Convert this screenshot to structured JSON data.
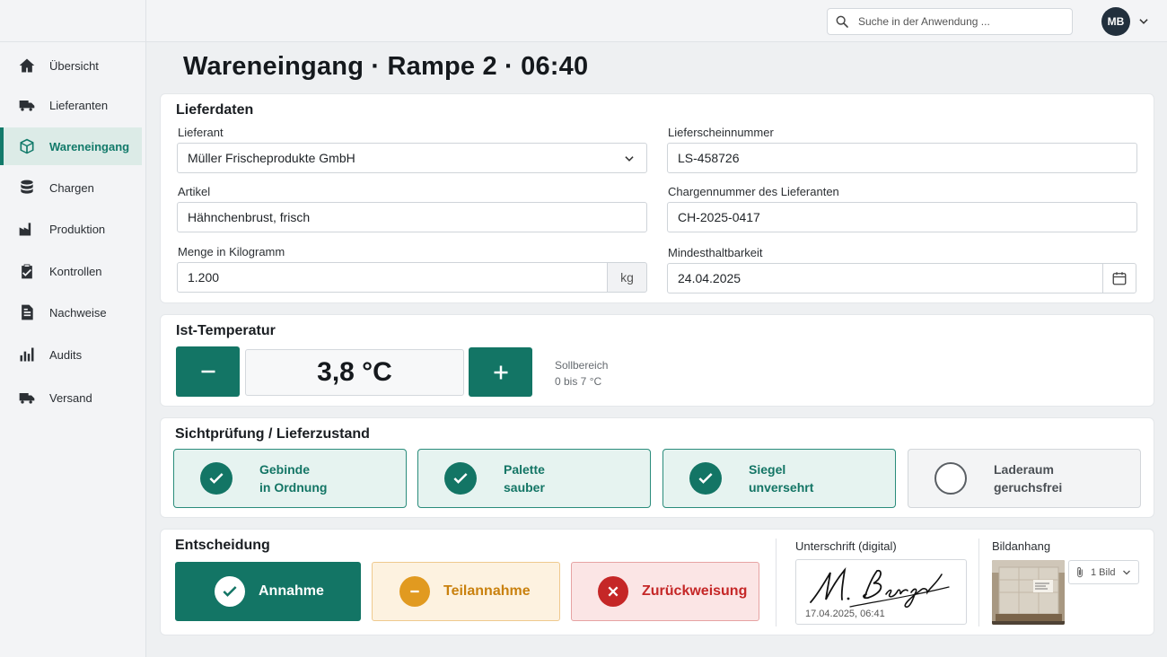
{
  "sidebar": {
    "items": [
      {
        "label": "Übersicht",
        "icon": "home-icon"
      },
      {
        "label": "Lieferanten",
        "icon": "truck-icon"
      },
      {
        "label": "Wareneingang",
        "icon": "box-icon",
        "active": true
      },
      {
        "label": "Chargen",
        "icon": "database-icon"
      },
      {
        "label": "Produktion",
        "icon": "factory-icon"
      },
      {
        "label": "Kontrollen",
        "icon": "clipboard-check-icon"
      },
      {
        "label": "Nachweise",
        "icon": "document-icon"
      },
      {
        "label": "Audits",
        "icon": "bar-chart-icon"
      },
      {
        "label": "Versand",
        "icon": "truck-icon"
      }
    ]
  },
  "header": {
    "search_placeholder": "Suche in der Anwendung ...",
    "avatar_initials": "MB"
  },
  "page": {
    "title": "Wareneingang · Rampe 2 · 06:40"
  },
  "lieferdaten": {
    "title": "Lieferdaten",
    "lieferant_label": "Lieferant",
    "lieferant_value": "Müller Frischeprodukte GmbH",
    "lieferschein_label": "Lieferscheinnummer",
    "lieferschein_value": "LS-458726",
    "artikel_label": "Artikel",
    "artikel_value": "Hähnchenbrust, frisch",
    "charge_label": "Chargennummer des Lieferanten",
    "charge_value": "CH-2025-0417",
    "menge_label": "Menge in Kilogramm",
    "menge_value": "1.200",
    "menge_unit": "kg",
    "mhd_label": "Mindesthaltbarkeit",
    "mhd_value": "24.04.2025"
  },
  "temperatur": {
    "title": "Ist-Temperatur",
    "value": "3,8 °C",
    "soll_label": "Sollbereich",
    "soll_range": "0 bis 7 °C"
  },
  "sichtpruefung": {
    "title": "Sichtprüfung / Lieferzustand",
    "items": [
      {
        "line1": "Gebinde",
        "line2": "in Ordnung",
        "checked": true
      },
      {
        "line1": "Palette",
        "line2": "sauber",
        "checked": true
      },
      {
        "line1": "Siegel",
        "line2": "unversehrt",
        "checked": true
      },
      {
        "line1": "Laderaum",
        "line2": "geruchsfrei",
        "checked": false
      }
    ]
  },
  "entscheidung": {
    "title": "Entscheidung",
    "accept": "Annahme",
    "partial": "Teilannahme",
    "reject": "Zurückweisung",
    "selected": "Annahme"
  },
  "unterschrift": {
    "label": "Unterschrift (digital)",
    "name": "M. Berger",
    "timestamp": "17.04.2025, 06:41"
  },
  "bildanhang": {
    "label": "Bildanhang",
    "count_label": "1 Bild"
  },
  "colors": {
    "accent": "#137565",
    "warning": "#e19a20",
    "danger": "#c52727"
  }
}
